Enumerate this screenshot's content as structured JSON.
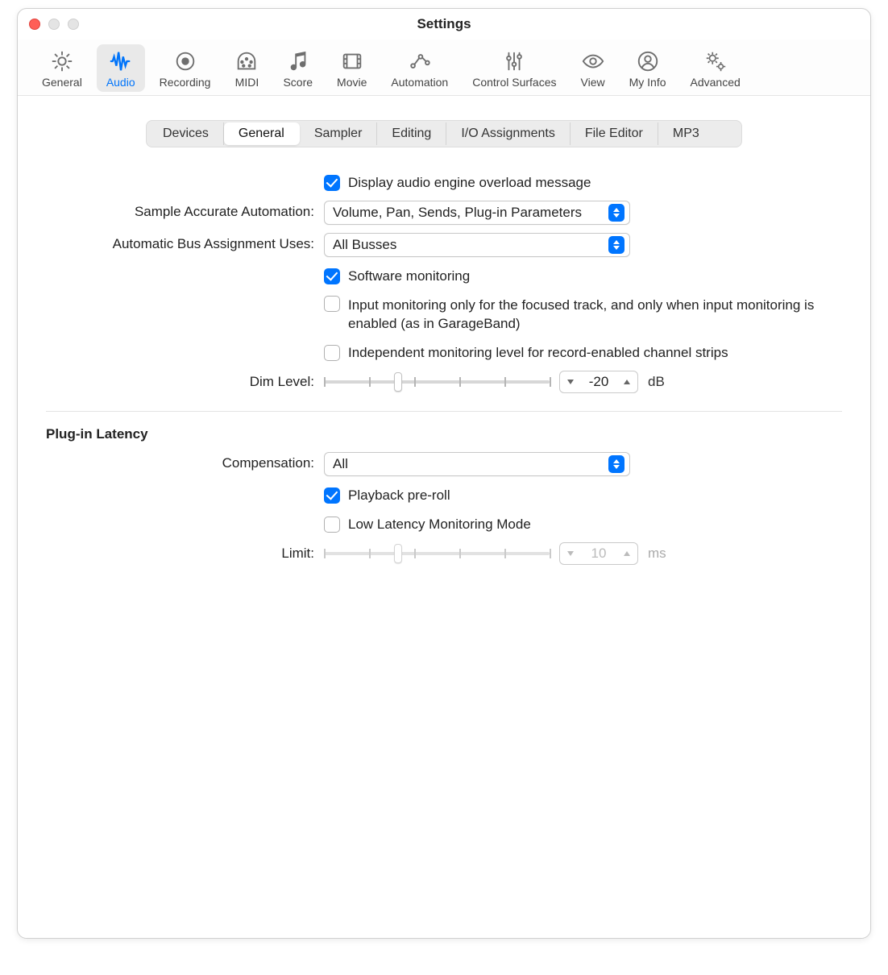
{
  "window": {
    "title": "Settings"
  },
  "toolbar": {
    "items": [
      {
        "key": "general",
        "label": "General"
      },
      {
        "key": "audio",
        "label": "Audio"
      },
      {
        "key": "recording",
        "label": "Recording"
      },
      {
        "key": "midi",
        "label": "MIDI"
      },
      {
        "key": "score",
        "label": "Score"
      },
      {
        "key": "movie",
        "label": "Movie"
      },
      {
        "key": "automation",
        "label": "Automation"
      },
      {
        "key": "controlsurfaces",
        "label": "Control Surfaces"
      },
      {
        "key": "view",
        "label": "View"
      },
      {
        "key": "myinfo",
        "label": "My Info"
      },
      {
        "key": "advanced",
        "label": "Advanced"
      }
    ],
    "active": "audio"
  },
  "subtabs": {
    "items": [
      "Devices",
      "General",
      "Sampler",
      "Editing",
      "I/O Assignments",
      "File Editor",
      "MP3"
    ],
    "active": "General"
  },
  "audio_general": {
    "display_overload": {
      "label": "Display audio engine overload message",
      "checked": true
    },
    "sample_accurate": {
      "label": "Sample Accurate Automation:",
      "value": "Volume, Pan, Sends, Plug-in Parameters"
    },
    "bus_assignment": {
      "label": "Automatic Bus Assignment Uses:",
      "value": "All Busses"
    },
    "software_monitoring": {
      "label": "Software monitoring",
      "checked": true
    },
    "input_monitoring_focused": {
      "label": "Input monitoring only for the focused track, and only when input monitoring is enabled (as in GarageBand)",
      "checked": false
    },
    "independent_monitoring": {
      "label": "Independent monitoring level for record-enabled channel strips",
      "checked": false
    },
    "dim_level": {
      "label": "Dim Level:",
      "value": "-20",
      "unit": "dB"
    }
  },
  "latency": {
    "title": "Plug-in Latency",
    "compensation": {
      "label": "Compensation:",
      "value": "All"
    },
    "playback_preroll": {
      "label": "Playback pre-roll",
      "checked": true
    },
    "low_latency": {
      "label": "Low Latency Monitoring Mode",
      "checked": false
    },
    "limit": {
      "label": "Limit:",
      "value": "10",
      "unit": "ms"
    }
  }
}
